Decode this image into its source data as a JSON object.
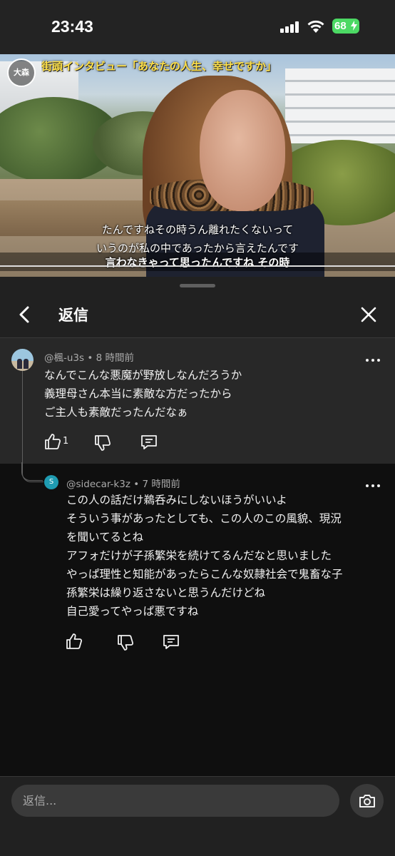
{
  "status_bar": {
    "time": "23:43",
    "battery": "68"
  },
  "video": {
    "channel_logo": "大森",
    "title": "街頭インタビュー「あなたの人生、幸せですか」",
    "caption_line1": "たんですねその時うん離れたくないって",
    "caption_line2": "いうのが私の中であったから言えたんです",
    "caption_line3": "言わなきゃって思ったんですね その時"
  },
  "panel": {
    "title": "返信",
    "parent_comment": {
      "author": "@楓-u3s",
      "time": "8 時間前",
      "lines": [
        "なんでこんな悪魔が野放しなんだろうか",
        "義理母さん本当に素敵な方だったから",
        "ご主人も素敵だったんだなぁ"
      ],
      "like_count": "1"
    },
    "reply": {
      "avatar_letter": "S",
      "author": "@sidecar-k3z",
      "time": "7 時間前",
      "lines": [
        "この人の話だけ鵜呑みにしないほうがいいよ",
        "そういう事があったとしても、この人のこの風貌、現況",
        "を聞いてるとね",
        "アフォだけが子孫繁栄を続けてるんだなと思いました",
        "やっぱ理性と知能があったらこんな奴隷社会で鬼畜な子",
        "孫繁栄は繰り返さないと思うんだけどね",
        "自己愛ってやっぱ悪ですね"
      ]
    },
    "reply_input_placeholder": "返信..."
  },
  "colors": {
    "panel_bg": "#212121",
    "reply_bg": "#0f0f0f",
    "battery": "#4cd964",
    "reply_avatar": "#1f9bb1"
  },
  "icons": [
    "back-icon",
    "close-icon",
    "more-icon",
    "like-icon",
    "dislike-icon",
    "comment-icon",
    "camera-icon"
  ]
}
